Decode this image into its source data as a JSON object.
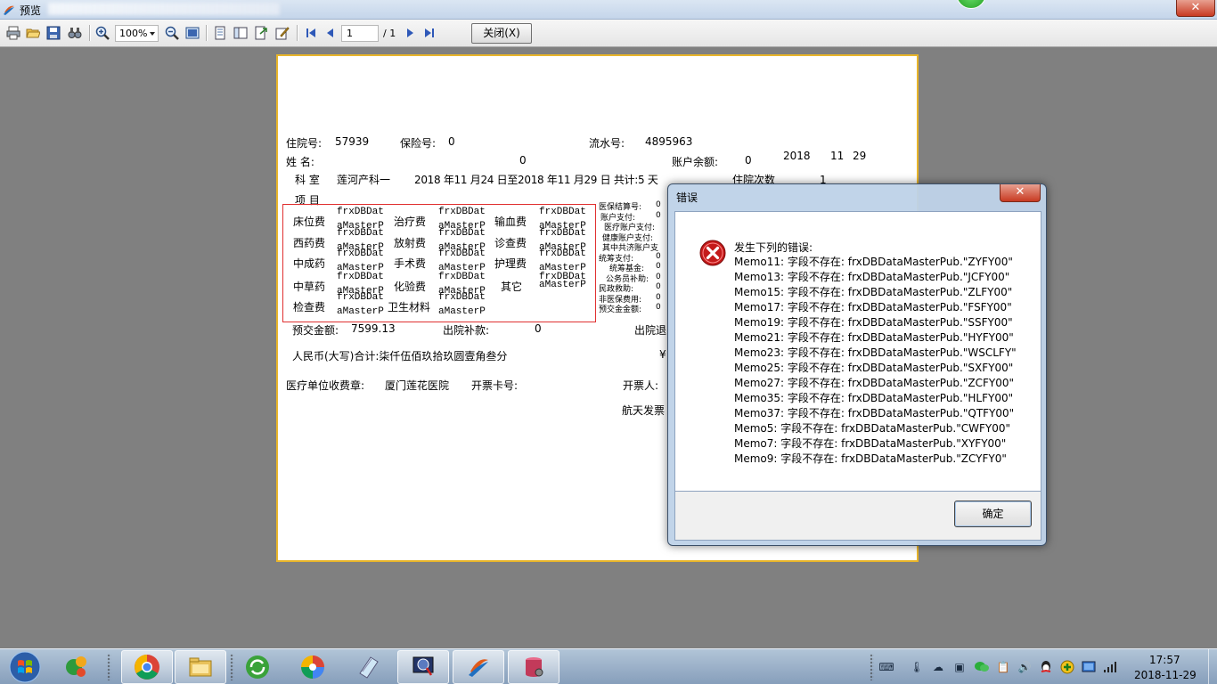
{
  "window": {
    "title": "预览"
  },
  "toolbar": {
    "zoom": "100%",
    "page_current": "1",
    "page_total": "/ 1",
    "close_label": "关闭(X)",
    "icons": [
      "print-icon",
      "open-icon",
      "save-icon",
      "find-icon",
      "zoom-in-icon",
      "zoom-out-icon",
      "fullscreen-icon",
      "page-setup-icon",
      "outline-icon",
      "export-icon",
      "edit-icon",
      "first-page-icon",
      "prev-page-icon",
      "next-page-icon",
      "last-page-icon"
    ]
  },
  "report": {
    "zhuyuan_label": "住院号:",
    "zhuyuan_value": "57939",
    "baoxian_label": "保险号:",
    "baoxian_value": "0",
    "liushui_label": "流水号:",
    "liushui_value": "4895963",
    "name_label": "姓  名:",
    "name_value": "0",
    "balance_label": "账户余额:",
    "balance_value": "0",
    "date_year": "2018",
    "date_month": "11",
    "date_day": "29",
    "dept_label": "科  室",
    "dept_value": "莲河产科一",
    "period_text": "2018 年11 月24 日至2018 年11 月29 日  共计:5   天",
    "times_label": "住院次数",
    "times_value": "1",
    "items_label": "项  目",
    "fees": [
      [
        "床位费",
        "治疗费",
        "输血费"
      ],
      [
        "西药费",
        "放射费",
        "诊查费"
      ],
      [
        "中成药",
        "手术费",
        "护理费"
      ],
      [
        "中草药",
        "化验费",
        "其它"
      ],
      [
        "检查费",
        "卫生材料"
      ]
    ],
    "field_top": "frxDBDat",
    "field_bottom": "aMasterP",
    "side": [
      {
        "label": "医保结算号:",
        "value": "0"
      },
      {
        "label": "账户支付:",
        "value": "0"
      },
      {
        "label": "医疗账户支付:",
        "value": ""
      },
      {
        "label": "健康账户支付:",
        "value": ""
      },
      {
        "label": "其中共济账户支",
        "value": ""
      },
      {
        "label": "统筹支付:",
        "value": "0"
      },
      {
        "label": "统筹基金:",
        "value": "0"
      },
      {
        "label": "公务员补助:",
        "value": "0"
      },
      {
        "label": "民政救助:",
        "value": "0"
      },
      {
        "label": "非医保费用:",
        "value": "0"
      },
      {
        "label": "预交金金额:",
        "value": "0"
      }
    ],
    "deposit_label": "预交金额:",
    "deposit_value": "7599.13",
    "supplement_label": "出院补款:",
    "supplement_value": "0",
    "refund_label": "出院退",
    "rmb_text": "人民币(大写)合计:柒仟伍佰玖拾玖圆壹角叁分",
    "yen_symbol": "¥",
    "hospital_label": "医疗单位收费章:",
    "hospital_value": "厦门莲花医院",
    "card_label": "开票卡号:",
    "issuer_label": "开票人:",
    "invoice_label": "航天发票"
  },
  "dialog": {
    "title": "错误",
    "heading": "发生下列的错误:",
    "lines": [
      "Memo11: 字段不存在: frxDBDataMasterPub.\"ZYFY00\"",
      "Memo13: 字段不存在: frxDBDataMasterPub.\"JCFY00\"",
      "Memo15: 字段不存在: frxDBDataMasterPub.\"ZLFY00\"",
      "Memo17: 字段不存在: frxDBDataMasterPub.\"FSFY00\"",
      "Memo19: 字段不存在: frxDBDataMasterPub.\"SSFY00\"",
      "Memo21: 字段不存在: frxDBDataMasterPub.\"HYFY00\"",
      "Memo23: 字段不存在: frxDBDataMasterPub.\"WSCLFY\"",
      "Memo25: 字段不存在: frxDBDataMasterPub.\"SXFY00\"",
      "Memo27: 字段不存在: frxDBDataMasterPub.\"ZCFY00\"",
      "Memo35: 字段不存在: frxDBDataMasterPub.\"HLFY00\"",
      "Memo37: 字段不存在: frxDBDataMasterPub.\"QTFY00\"",
      "Memo5: 字段不存在: frxDBDataMasterPub.\"CWFY00\"",
      "Memo7: 字段不存在: frxDBDataMasterPub.\"XYFY00\"",
      "Memo9: 字段不存在: frxDBDataMasterPub.\"ZCYFY0\""
    ],
    "ok_label": "确定"
  },
  "taskbar": {
    "apps": [
      "app-360-icon",
      "chrome-icon",
      "file-explorer-icon",
      "refresh-app-icon",
      "color-app-icon",
      "notepad-icon",
      "monitor-app-icon",
      "report-app-icon",
      "database-app-icon"
    ],
    "clock_time": "17:57",
    "clock_date": "2018-11-29"
  }
}
